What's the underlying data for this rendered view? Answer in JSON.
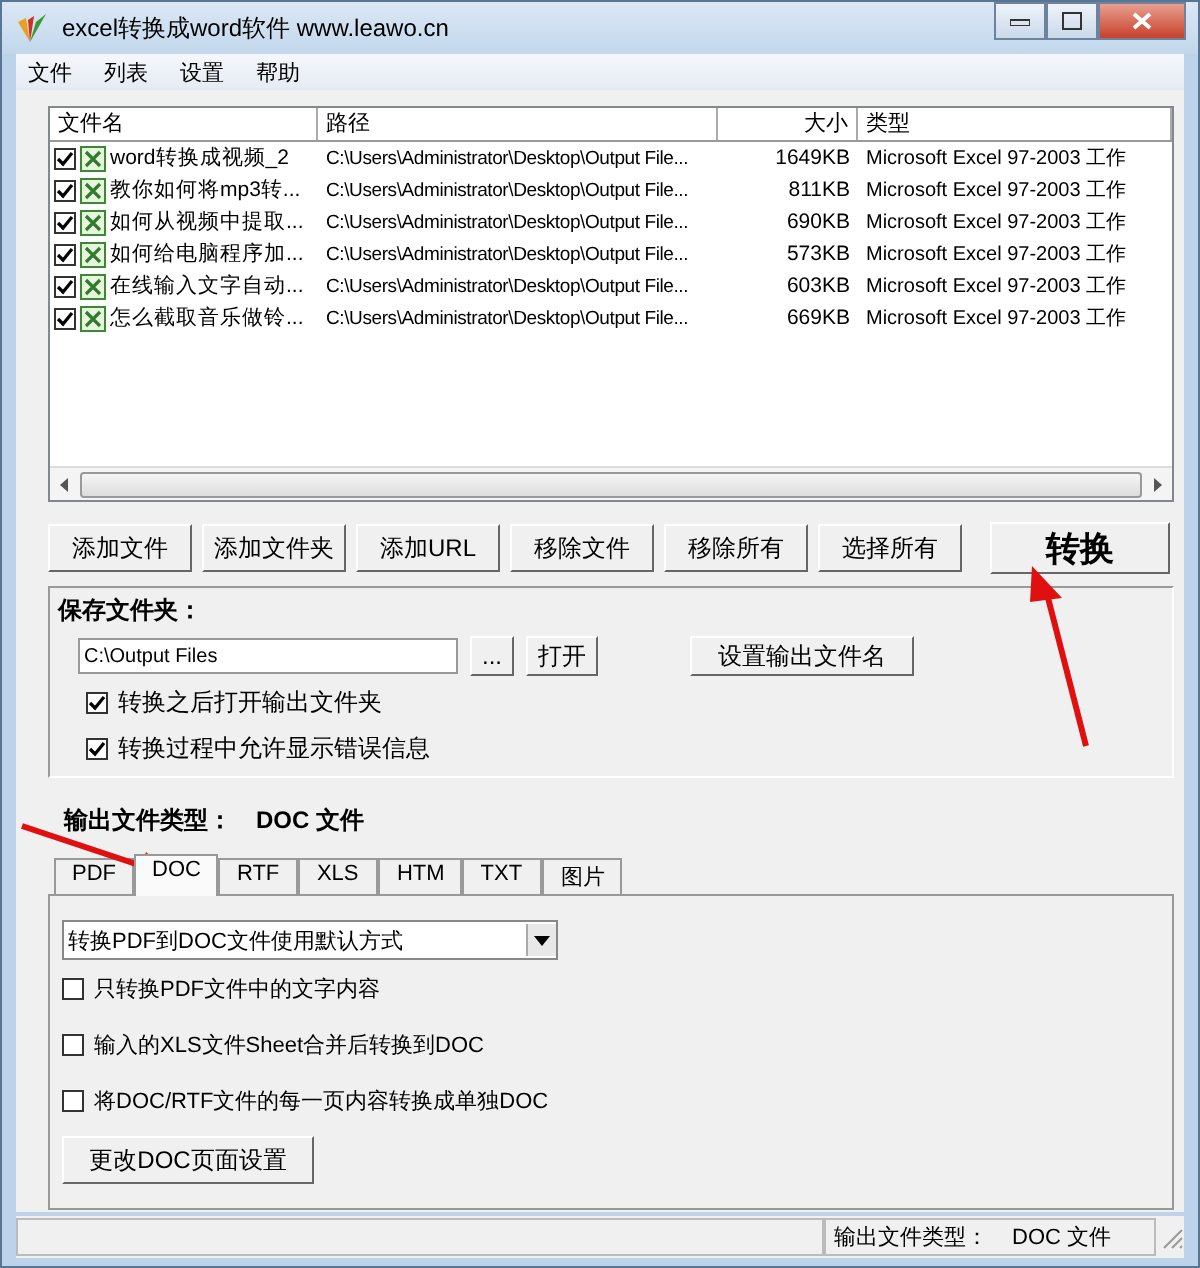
{
  "window": {
    "title": "excel转换成word软件  www.leawo.cn"
  },
  "menu": [
    "文件",
    "列表",
    "设置",
    "帮助"
  ],
  "file_list": {
    "columns": [
      "文件名",
      "路径",
      "大小",
      "类型"
    ],
    "rows": [
      {
        "checked": true,
        "name": "word转换成视频_2",
        "path": "C:\\Users\\Administrator\\Desktop\\Output File...",
        "size": "1649KB",
        "type": "Microsoft Excel 97-2003 工作"
      },
      {
        "checked": true,
        "name": "教你如何将mp3转...",
        "path": "C:\\Users\\Administrator\\Desktop\\Output File...",
        "size": "811KB",
        "type": "Microsoft Excel 97-2003 工作"
      },
      {
        "checked": true,
        "name": "如何从视频中提取...",
        "path": "C:\\Users\\Administrator\\Desktop\\Output File...",
        "size": "690KB",
        "type": "Microsoft Excel 97-2003 工作"
      },
      {
        "checked": true,
        "name": "如何给电脑程序加...",
        "path": "C:\\Users\\Administrator\\Desktop\\Output File...",
        "size": "573KB",
        "type": "Microsoft Excel 97-2003 工作"
      },
      {
        "checked": true,
        "name": "在线输入文字自动...",
        "path": "C:\\Users\\Administrator\\Desktop\\Output File...",
        "size": "603KB",
        "type": "Microsoft Excel 97-2003 工作"
      },
      {
        "checked": true,
        "name": "怎么截取音乐做铃...",
        "path": "C:\\Users\\Administrator\\Desktop\\Output File...",
        "size": "669KB",
        "type": "Microsoft Excel 97-2003 工作"
      }
    ]
  },
  "buttons": [
    "添加文件",
    "添加文件夹",
    "添加URL",
    "移除文件",
    "移除所有",
    "选择所有"
  ],
  "convert_button": "转换",
  "save_folder": {
    "label": "保存文件夹：",
    "path": "C:\\Output Files",
    "browse": "...",
    "open": "打开",
    "rename": "设置输出文件名",
    "options": [
      {
        "label": "转换之后打开输出文件夹",
        "checked": true
      },
      {
        "label": "转换过程中允许显示错误信息",
        "checked": true
      }
    ]
  },
  "output_type": {
    "label": "输出文件类型：",
    "value": "DOC 文件"
  },
  "tabs": [
    {
      "label": "PDF",
      "selected": false
    },
    {
      "label": "DOC",
      "selected": true
    },
    {
      "label": "RTF",
      "selected": false
    },
    {
      "label": "XLS",
      "selected": false
    },
    {
      "label": "HTM",
      "selected": false
    },
    {
      "label": "TXT",
      "selected": false
    },
    {
      "label": "图片",
      "selected": false
    }
  ],
  "doc_panel": {
    "mode": "转换PDF到DOC文件使用默认方式",
    "options": [
      {
        "label": "只转换PDF文件中的文字内容",
        "checked": false
      },
      {
        "label": "输入的XLS文件Sheet合并后转换到DOC",
        "checked": false
      },
      {
        "label": "将DOC/RTF文件的每一页内容转换成单独DOC",
        "checked": false
      }
    ],
    "button": "更改DOC页面设置"
  },
  "status_bar": {
    "label": "输出文件类型：",
    "value": "DOC 文件"
  }
}
